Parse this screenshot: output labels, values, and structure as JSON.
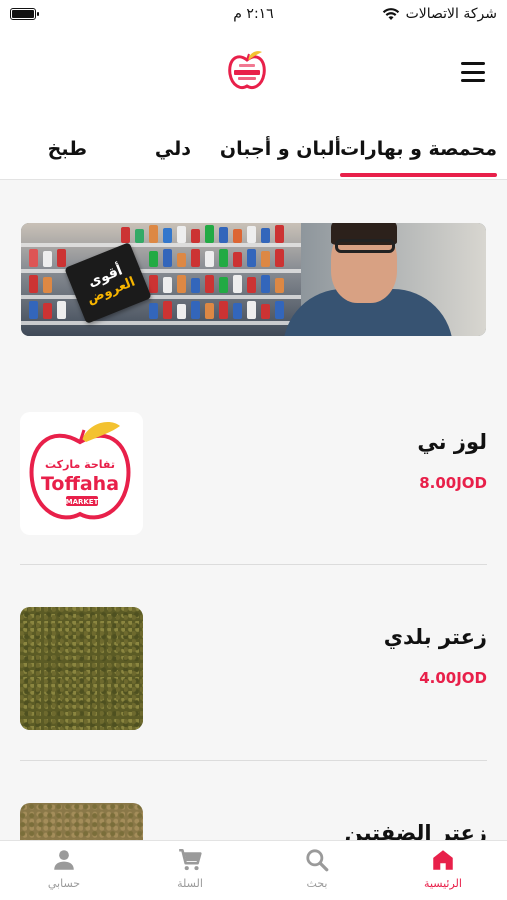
{
  "status_bar": {
    "carrier": "شركة الاتصالات",
    "time": "٢:١٦ م",
    "battery_level": 1.0
  },
  "header": {
    "logo_text": "Toffaha",
    "menu_icon": "hamburger-menu-icon"
  },
  "tabs": [
    {
      "label": "محمصة و بهارات",
      "active": true
    },
    {
      "label": "ألبان و أجبان",
      "active": false
    },
    {
      "label": "دلي",
      "active": false
    },
    {
      "label": "طبخ",
      "active": false
    }
  ],
  "banner": {
    "sticker_line1": "أقوى",
    "sticker_line2": "العروض"
  },
  "logo": {
    "arabic": "تفاحة ماركت",
    "name": "Toffaha",
    "sub": "MARKET"
  },
  "products": [
    {
      "name": "لوز ني",
      "price": "8.00JOD"
    },
    {
      "name": "زعتر بلدي",
      "price": "4.00JOD"
    },
    {
      "name": "زعتر الضفتين",
      "price": ""
    }
  ],
  "bottom_nav": [
    {
      "label": "الرئيسية",
      "icon": "home-icon",
      "active": true
    },
    {
      "label": "بحث",
      "icon": "search-icon",
      "active": false
    },
    {
      "label": "السلة",
      "icon": "cart-icon",
      "active": false
    },
    {
      "label": "حسابي",
      "icon": "user-icon",
      "active": false
    }
  ],
  "colors": {
    "accent": "#e8204a",
    "logo_yellow": "#f3c230"
  }
}
